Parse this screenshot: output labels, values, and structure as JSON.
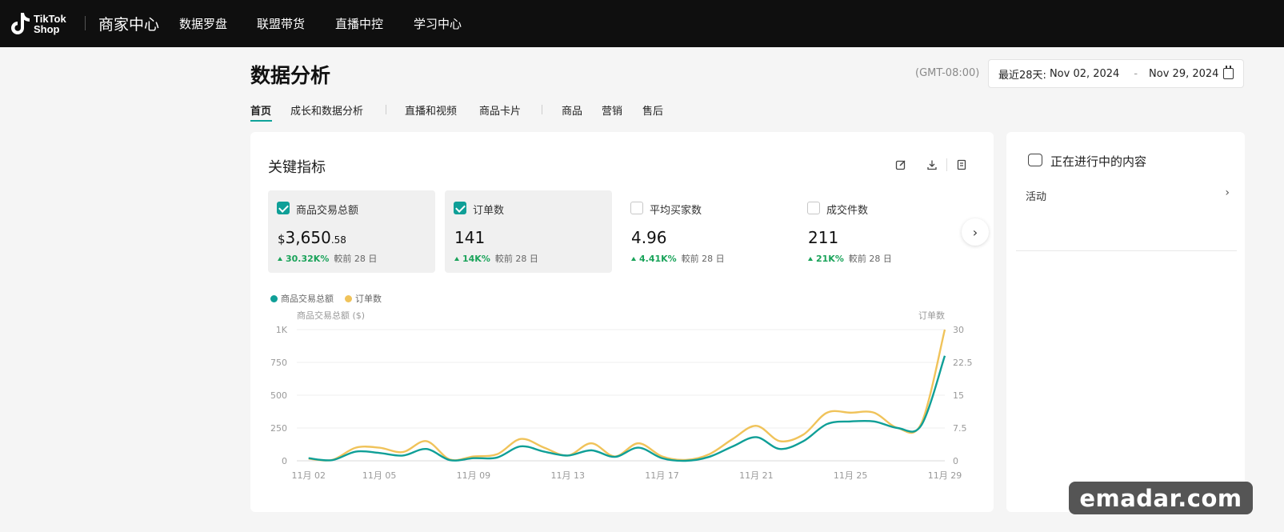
{
  "nav": {
    "logo_line1": "TikTok",
    "logo_line2": "Shop",
    "brand": "商家中心",
    "items": [
      "数据罗盘",
      "联盟带货",
      "直播中控",
      "学习中心"
    ]
  },
  "page": {
    "title": "数据分析",
    "timezone": "(GMT-08:00)",
    "date_prefix": "最近28天:",
    "date_start": "Nov 02, 2024",
    "date_sep": "-",
    "date_end": "Nov 29, 2024"
  },
  "tabs": [
    "首页",
    "成长和数据分析",
    "直播和视频",
    "商品卡片",
    "商品",
    "营销",
    "售后"
  ],
  "card": {
    "title": "关键指标",
    "tool_icons": [
      "edit-icon",
      "download-icon",
      "document-icon"
    ]
  },
  "metrics": [
    {
      "label": "商品交易总额",
      "currency": "$",
      "value": "3,650",
      "decimal": ".58",
      "change": "30.32K%",
      "compare": "較前 28 日",
      "checked": true
    },
    {
      "label": "订单数",
      "currency": "",
      "value": "141",
      "decimal": "",
      "change": "14K%",
      "compare": "較前 28 日",
      "checked": true
    },
    {
      "label": "平均买家数",
      "currency": "",
      "value": "4.96",
      "decimal": "",
      "change": "4.41K%",
      "compare": "較前 28 日",
      "checked": false
    },
    {
      "label": "成交件数",
      "currency": "",
      "value": "211",
      "decimal": "",
      "change": "21K%",
      "compare": "較前 28 日",
      "checked": false
    }
  ],
  "chart_data": {
    "type": "line",
    "left_axis_label": "商品交易总额 ($)",
    "right_axis_label": "订单数",
    "x_tick_labels": [
      "11月 02",
      "11月 05",
      "11月 09",
      "11月 13",
      "11月 17",
      "11月 21",
      "11月 25",
      "11月 29"
    ],
    "x_tick_days": [
      2,
      5,
      9,
      13,
      17,
      21,
      25,
      29
    ],
    "left_ticks": [
      "0",
      "250",
      "500",
      "750",
      "1K"
    ],
    "right_ticks": [
      "0",
      "7.5",
      "15",
      "22.5",
      "30"
    ],
    "ylim_left": [
      0,
      1000
    ],
    "ylim_right": [
      0,
      30
    ],
    "series": [
      {
        "name": "商品交易总额",
        "axis": "left",
        "color": "#0f9f97",
        "days": [
          2,
          3,
          4,
          5,
          6,
          7,
          8,
          9,
          10,
          11,
          12,
          13,
          14,
          15,
          16,
          17,
          18,
          19,
          20,
          21,
          22,
          23,
          24,
          25,
          26,
          27,
          28,
          29
        ],
        "values": [
          20,
          5,
          70,
          60,
          40,
          90,
          5,
          20,
          25,
          110,
          70,
          40,
          80,
          30,
          100,
          20,
          0,
          30,
          110,
          180,
          90,
          150,
          280,
          300,
          300,
          250,
          270,
          800
        ]
      },
      {
        "name": "订单数",
        "axis": "right",
        "color": "#f0c35a",
        "days": [
          2,
          3,
          4,
          5,
          6,
          7,
          8,
          9,
          10,
          11,
          12,
          13,
          14,
          15,
          16,
          17,
          18,
          19,
          20,
          21,
          22,
          23,
          24,
          25,
          26,
          27,
          28,
          29
        ],
        "values": [
          0.5,
          0.2,
          3,
          3,
          2,
          4.5,
          0.3,
          1,
          1.5,
          5,
          3,
          1.2,
          4,
          1,
          4,
          1,
          0.2,
          1.5,
          5,
          8,
          4.5,
          6,
          11,
          11,
          11,
          7.5,
          8.5,
          30
        ]
      }
    ]
  },
  "side": {
    "title": "正在进行中的内容",
    "row_label": "活动"
  },
  "watermark": "emadar.com"
}
